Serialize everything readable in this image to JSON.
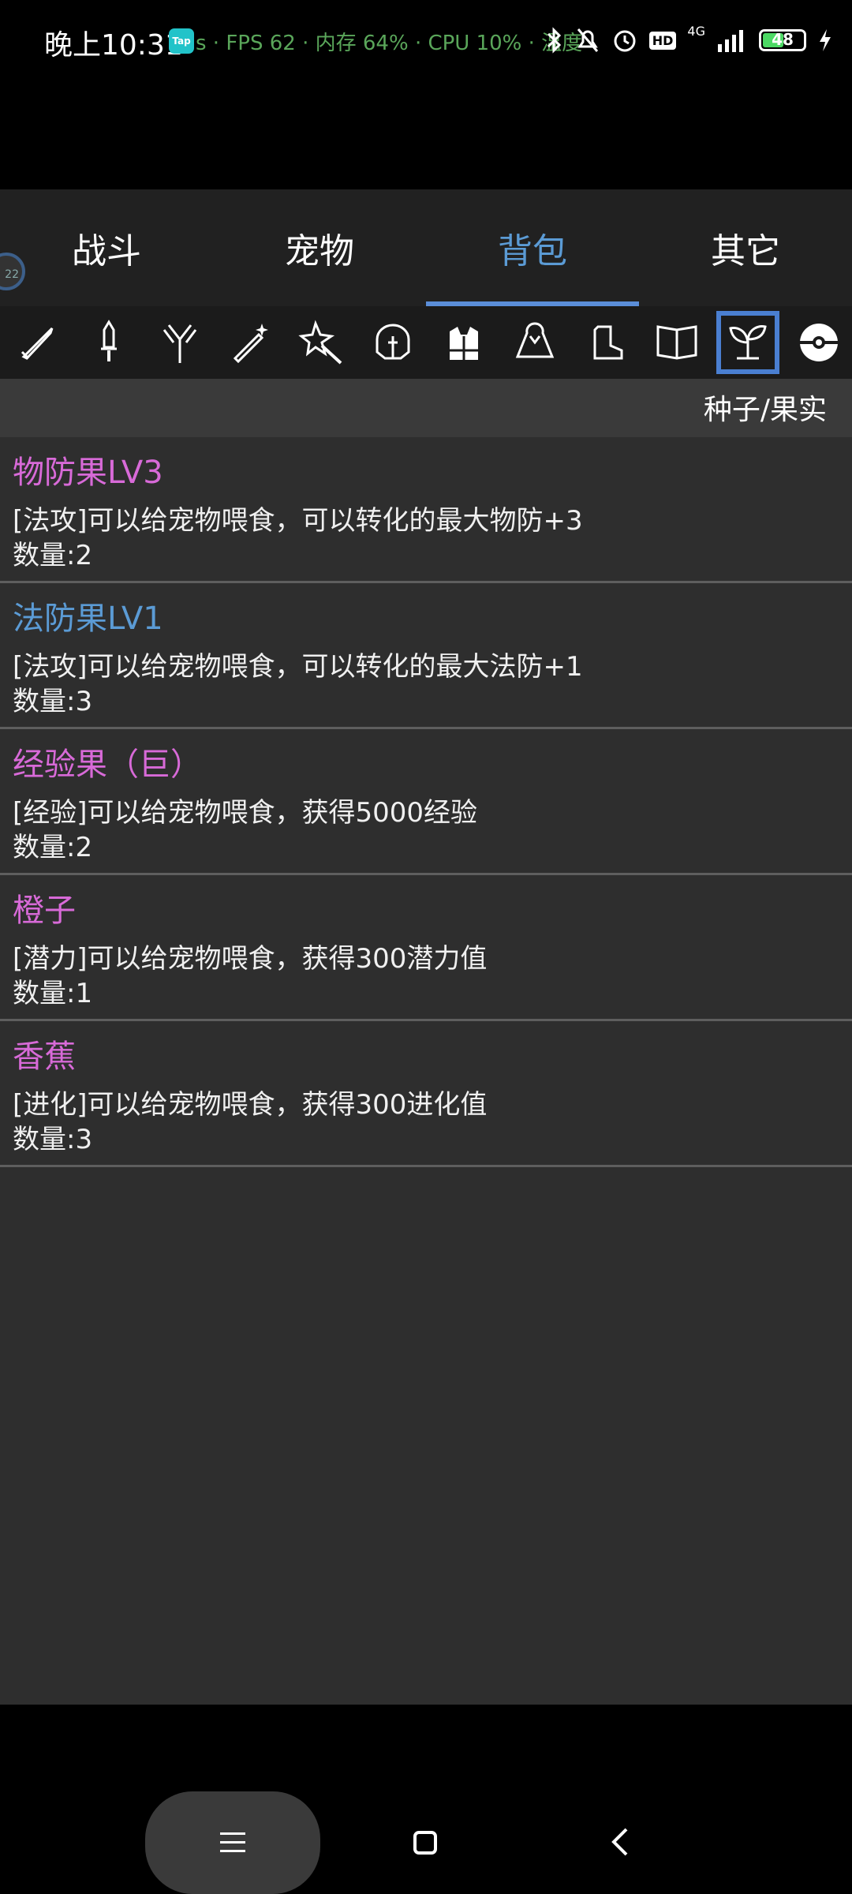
{
  "status": {
    "time": "晚上10:31",
    "tap_badge": "Tap",
    "overlay_fps": "s · FPS 62 · 内存 64% · CPU 10% · 温度 ",
    "network": "4G",
    "hd_badge": "HD",
    "battery": "48"
  },
  "avatar_text": "22",
  "tabs": [
    {
      "label": "战斗"
    },
    {
      "label": "宠物"
    },
    {
      "label": "背包"
    },
    {
      "label": "其它"
    }
  ],
  "categories": [
    "sword-icon",
    "dagger-icon",
    "staff-icon",
    "magic-wand-icon",
    "sparkle-wand-icon",
    "helmet-icon",
    "armor-icon",
    "cloak-icon",
    "boots-icon",
    "book-icon",
    "seed-icon",
    "pokeball-icon"
  ],
  "filter": {
    "label": "种子/果实"
  },
  "colors": {
    "accent": "#5b9bd5",
    "item_pink": "#d86ad8",
    "item_blue": "#5b9bd5"
  },
  "items": [
    {
      "name": "物防果LV3",
      "color": "#d86ad8",
      "desc": "[法攻]可以给宠物喂食，可以转化的最大物防+3",
      "qty": "数量:2"
    },
    {
      "name": "法防果LV1",
      "color": "#5b9bd5",
      "desc": "[法攻]可以给宠物喂食，可以转化的最大法防+1",
      "qty": "数量:3"
    },
    {
      "name": "经验果（巨）",
      "color": "#d86ad8",
      "desc": "[经验]可以给宠物喂食，获得5000经验",
      "qty": "数量:2"
    },
    {
      "name": "橙子",
      "color": "#d86ad8",
      "desc": "[潜力]可以给宠物喂食，获得300潜力值",
      "qty": "数量:1"
    },
    {
      "name": "香蕉",
      "color": "#d86ad8",
      "desc": "[进化]可以给宠物喂食，获得300进化值",
      "qty": "数量:3"
    }
  ]
}
